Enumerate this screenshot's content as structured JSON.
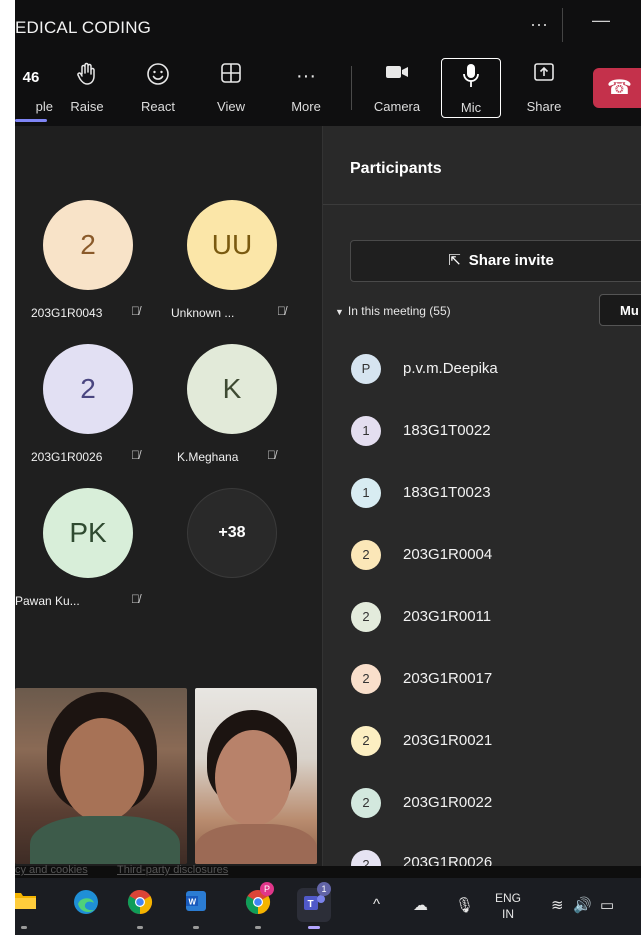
{
  "window": {
    "title": "EDICAL CODING",
    "more_dots": "···",
    "minimize": "—"
  },
  "toolbar": {
    "people": {
      "count": "46",
      "label": "ple"
    },
    "raise": {
      "label": "Raise"
    },
    "react": {
      "label": "React"
    },
    "view": {
      "label": "View"
    },
    "more": {
      "label": "More",
      "icon": "···"
    },
    "camera": {
      "label": "Camera"
    },
    "mic": {
      "label": "Mic"
    },
    "share": {
      "label": "Share"
    }
  },
  "stage": {
    "tiles": [
      {
        "initials": "2",
        "name": "203G1R0043",
        "color": "#f8e3c8"
      },
      {
        "initials": "UU",
        "name": "Unknown ...",
        "color": "#fbe6a8"
      },
      {
        "initials": "2",
        "name": "203G1R0026",
        "color": "#e2e0f3"
      },
      {
        "initials": "K",
        "name": "K.Meghana",
        "color": "#e2ead9"
      },
      {
        "initials": "PK",
        "name": "Pawan Ku...",
        "color": "#d8eed9"
      }
    ],
    "overflow": "+38"
  },
  "panel": {
    "title": "Participants",
    "share_invite": "Share invite",
    "in_meeting": "In this meeting (55)",
    "mute_all": "Mu",
    "participants": [
      {
        "initial": "P",
        "name": "p.v.m.Deepika",
        "color": "#d6e4f0"
      },
      {
        "initial": "1",
        "name": "183G1T0022",
        "color": "#e4def0"
      },
      {
        "initial": "1",
        "name": "183G1T0023",
        "color": "#d8ecf2"
      },
      {
        "initial": "2",
        "name": "203G1R0004",
        "color": "#fbe7b8"
      },
      {
        "initial": "2",
        "name": "203G1R0011",
        "color": "#e3ebdc"
      },
      {
        "initial": "2",
        "name": "203G1R0017",
        "color": "#f9dfcb"
      },
      {
        "initial": "2",
        "name": "203G1R0021",
        "color": "#fcefc2"
      },
      {
        "initial": "2",
        "name": "203G1R0022",
        "color": "#d3e8de"
      },
      {
        "initial": "2",
        "name": "203G1R0026",
        "color": "#e6e3f2"
      }
    ]
  },
  "footer_links": {
    "privacy": "cy and cookies",
    "third_party": "Third-party disclosures"
  },
  "taskbar": {
    "teams_badge": "1",
    "chrome_badge": "P",
    "lang": "ENG",
    "region": "IN"
  }
}
